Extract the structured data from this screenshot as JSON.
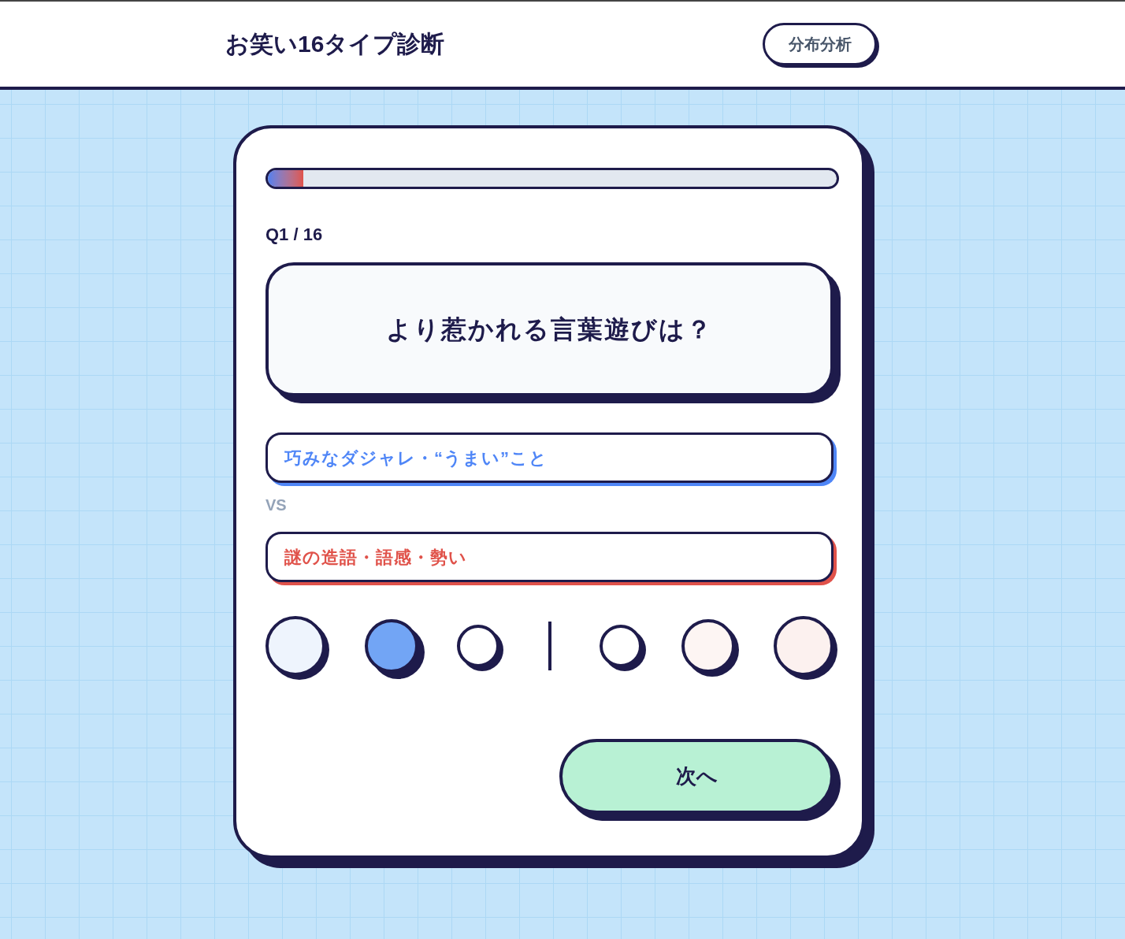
{
  "header": {
    "title": "お笑い16タイプ診断",
    "button": "分布分析"
  },
  "progress": {
    "level": 0.0625
  },
  "counter": "Q1 / 16",
  "question": "より惹かれる言葉遊びは？",
  "choices": [
    {
      "text": "巧みなダジャレ・“うまい”こと",
      "color": "#4f86f7"
    },
    {
      "text": "謎の造語・語感・勢い",
      "color": "#e0524a"
    }
  ],
  "separator": "VS",
  "scale": [
    {
      "kind": "large",
      "color": "#eef4fd",
      "selected": false
    },
    {
      "kind": "medium",
      "color": "#72a5f5",
      "selected": true
    },
    {
      "kind": "small",
      "color": "#ffffff",
      "selected": false
    },
    {
      "kind": "small",
      "color": "#ffffff",
      "selected": false
    },
    {
      "kind": "medium",
      "color": "#fdf5f3",
      "selected": false
    },
    {
      "kind": "large",
      "color": "#fcf1ef",
      "selected": false
    }
  ],
  "next_button": "次へ"
}
